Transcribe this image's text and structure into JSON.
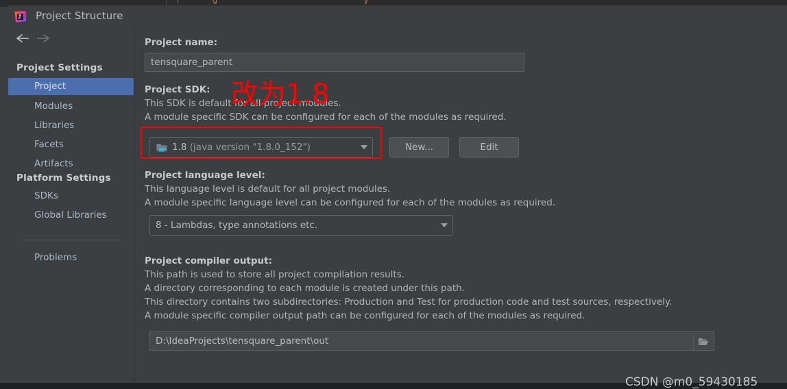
{
  "colors": {
    "dialog_bg": "#3c3f41",
    "sidebar_selected": "#4b6eaf",
    "text_primary": "#bbbbbb",
    "text_label": "#c8c8c8",
    "annotation_red": "#ff0000",
    "accent_orange": "#cc7832"
  },
  "background_strip": {
    "fragments": [
      "l",
      "g",
      "",
      "y"
    ]
  },
  "titlebar": {
    "icon": "intellij-idea-icon",
    "title": "Project Structure"
  },
  "navbar": {
    "back_icon": "arrow-left-icon",
    "forward_icon": "arrow-right-icon"
  },
  "sidebar": {
    "groups": [
      {
        "header": "Project Settings",
        "items": [
          {
            "label": "Project",
            "selected": true
          },
          {
            "label": "Modules",
            "selected": false
          },
          {
            "label": "Libraries",
            "selected": false
          },
          {
            "label": "Facets",
            "selected": false
          },
          {
            "label": "Artifacts",
            "selected": false
          }
        ]
      },
      {
        "header": "Platform Settings",
        "items": [
          {
            "label": "SDKs",
            "selected": false
          },
          {
            "label": "Global Libraries",
            "selected": false
          }
        ]
      }
    ],
    "extra_items": [
      {
        "label": "Problems",
        "selected": false
      }
    ]
  },
  "main": {
    "project_name": {
      "label": "Project name:",
      "value": "tensquare_parent",
      "placeholder": ""
    },
    "project_sdk": {
      "label": "Project SDK:",
      "description": [
        "This SDK is default for all project modules.",
        "A module specific SDK can be configured for each of the modules as required."
      ],
      "icon": "java-sdk-folder-icon",
      "value_name": "1.8",
      "value_detail": "(java version \"1.8.0_152\")",
      "dropdown_icon": "chevron-down-icon",
      "new_button": "New...",
      "edit_button": "Edit"
    },
    "language_level": {
      "label": "Project language level:",
      "description": [
        "This language level is default for all project modules.",
        "A module specific language level can be configured for each of the modules as required."
      ],
      "value": "8 - Lambdas, type annotations etc.",
      "dropdown_icon": "chevron-down-icon"
    },
    "compiler_output": {
      "label": "Project compiler output:",
      "description": [
        "This path is used to store all project compilation results.",
        "A directory corresponding to each module is created under this path.",
        "This directory contains two subdirectories: Production and Test for production code and test sources, respectively.",
        "A module specific compiler output path can be configured for each of the modules as required."
      ],
      "value": "D:\\IdeaProjects\\tensquare_parent\\out",
      "browse_icon": "folder-open-icon"
    }
  },
  "annotations": {
    "sdk_note": "改为1.8",
    "highlight_target": "project-sdk-combo"
  },
  "watermark": {
    "text": "CSDN @m0_59430185"
  }
}
